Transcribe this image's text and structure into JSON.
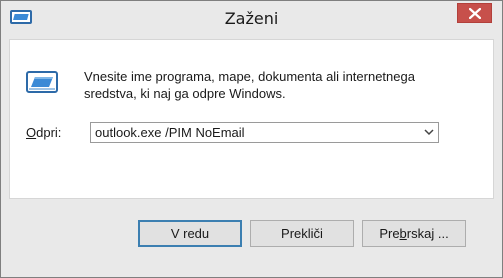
{
  "window": {
    "title": "Zaženi",
    "close_icon": "close-icon",
    "app_icon": "run-dialog-icon"
  },
  "body": {
    "run_icon": "run-dialog-icon",
    "description_line1": "Vnesite ime programa, mape, dokumenta ali internetnega",
    "description_line2": "sredstva, ki naj ga odpre Windows.",
    "open_label_prefix": "",
    "open_label_mnemonic": "O",
    "open_label_suffix": "dpri:",
    "open_value": "outlook.exe /PIM NoEmail",
    "dropdown_icon": "chevron-down-icon"
  },
  "buttons": {
    "ok_label": "V redu",
    "cancel_label": "Prekliči",
    "browse_prefix": "Pre",
    "browse_mnemonic": "b",
    "browse_suffix": "rskaj ..."
  },
  "colors": {
    "close_button": "#c7504b",
    "window_frame": "#e9e9e9",
    "default_button_border": "#3c7fb1"
  }
}
